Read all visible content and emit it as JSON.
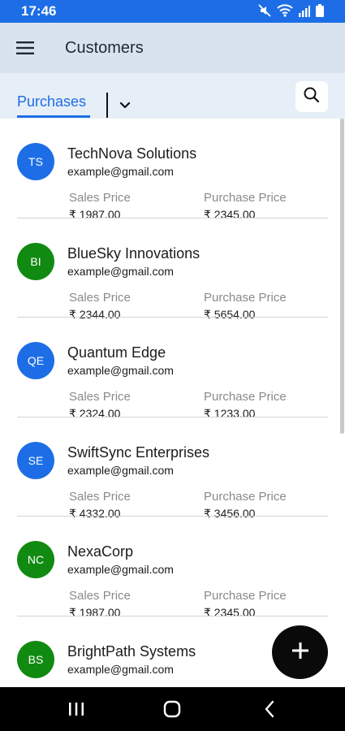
{
  "status_bar": {
    "time": "17:46",
    "icons": [
      "mute-icon",
      "wifi-icon",
      "signal-icon",
      "battery-icon"
    ]
  },
  "app_bar": {
    "title": "Customers",
    "menu_icon": "hamburger-menu-icon"
  },
  "tabs": {
    "active": "Purchases",
    "dropdown_icon": "chevron-down-icon",
    "search_icon": "search-icon"
  },
  "labels": {
    "sales": "Sales Price",
    "purchase": "Purchase Price"
  },
  "customers": [
    {
      "initials": "TS",
      "name": "TechNova Solutions",
      "email": "example@gmail.com",
      "sales": "₹ 1987.00",
      "purchase": "₹ 2345.00",
      "color": "#1d6ee6"
    },
    {
      "initials": "BI",
      "name": "BlueSky Innovations",
      "email": "example@gmail.com",
      "sales": "₹ 2344.00",
      "purchase": "₹ 5654.00",
      "color": "#118a11"
    },
    {
      "initials": "QE",
      "name": "Quantum Edge",
      "email": "example@gmail.com",
      "sales": "₹ 2324.00",
      "purchase": "₹ 1233.00",
      "color": "#1d6ee6"
    },
    {
      "initials": "SE",
      "name": "SwiftSync Enterprises",
      "email": "example@gmail.com",
      "sales": "₹ 4332.00",
      "purchase": "₹ 3456.00",
      "color": "#1d6ee6"
    },
    {
      "initials": "NC",
      "name": "NexaCorp",
      "email": "example@gmail.com",
      "sales": "₹ 1987.00",
      "purchase": "₹ 2345.00",
      "color": "#118a11"
    },
    {
      "initials": "BS",
      "name": "BrightPath Systems",
      "email": "example@gmail.com",
      "sales": "",
      "purchase": "",
      "color": "#118a11"
    }
  ],
  "fab": {
    "icon": "plus-icon"
  },
  "nav_bar": {
    "icons": [
      "recents-icon",
      "home-icon",
      "back-icon"
    ]
  }
}
